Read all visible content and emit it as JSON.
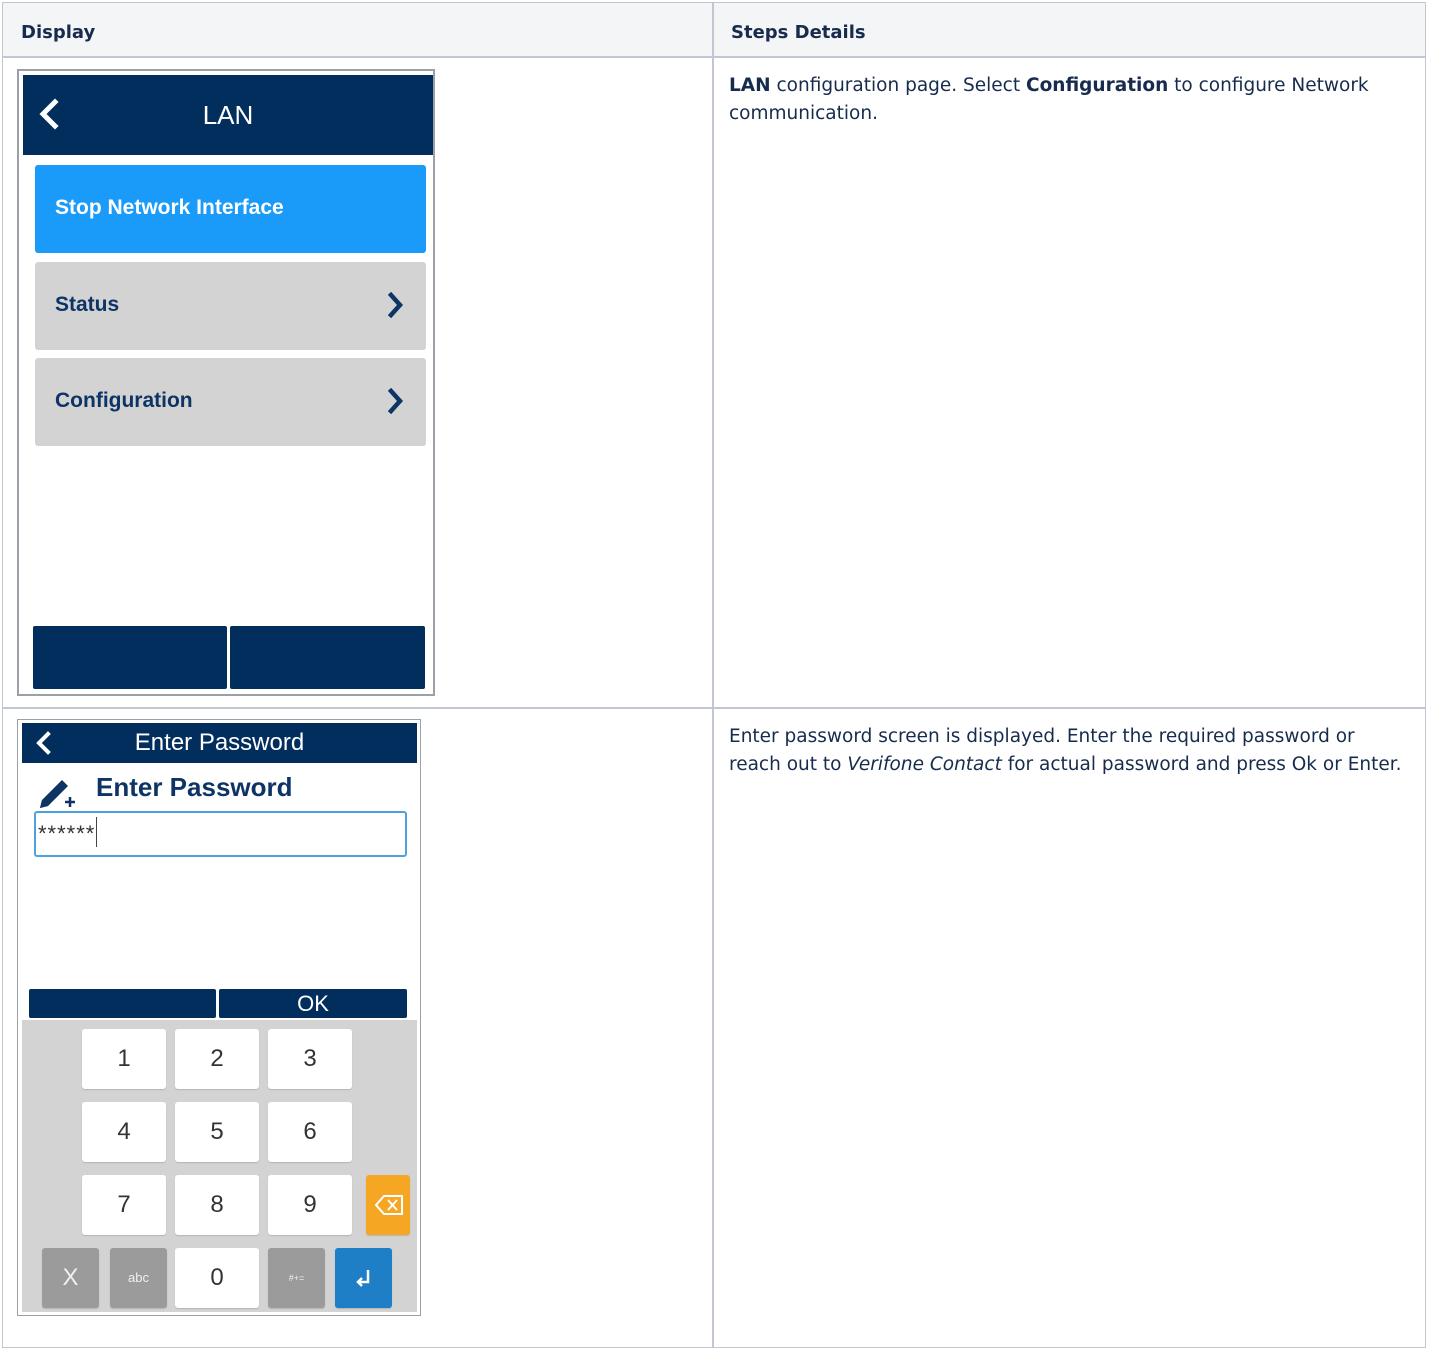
{
  "table": {
    "headers": [
      "Display",
      "Steps Details"
    ],
    "rows": [
      {
        "details": {
          "b1": "LAN",
          "t1": " configuration page. Select ",
          "b2": "Configuration",
          "t2": " to configure Network communication."
        }
      },
      {
        "details": {
          "t1": "Enter password screen is displayed. Enter the required password or reach out to ",
          "i1": "Verifone Contact",
          "t2": " for actual password and press Ok or Enter."
        }
      }
    ]
  },
  "lan_screen": {
    "title": "LAN",
    "items": [
      {
        "label": "Stop Network Interface",
        "state": "selected"
      },
      {
        "label": "Status"
      },
      {
        "label": "Configuration"
      }
    ]
  },
  "password_screen": {
    "title": "Enter Password",
    "prompt": "Enter Password",
    "input_value": "******",
    "ok_label": "OK",
    "keys": [
      "1",
      "2",
      "3",
      "4",
      "5",
      "6",
      "7",
      "8",
      "9",
      "X",
      "abc",
      "0",
      "#+="
    ],
    "icons": {
      "backspace": "backspace-icon",
      "enter": "enter-icon"
    }
  },
  "colors": {
    "header_navy": "#022e5e",
    "selected_blue": "#1a9bf9",
    "item_gray": "#d3d3d3",
    "item_text": "#0d3464",
    "backspace_orange": "#f5a623",
    "enter_blue": "#1e7fc6"
  }
}
